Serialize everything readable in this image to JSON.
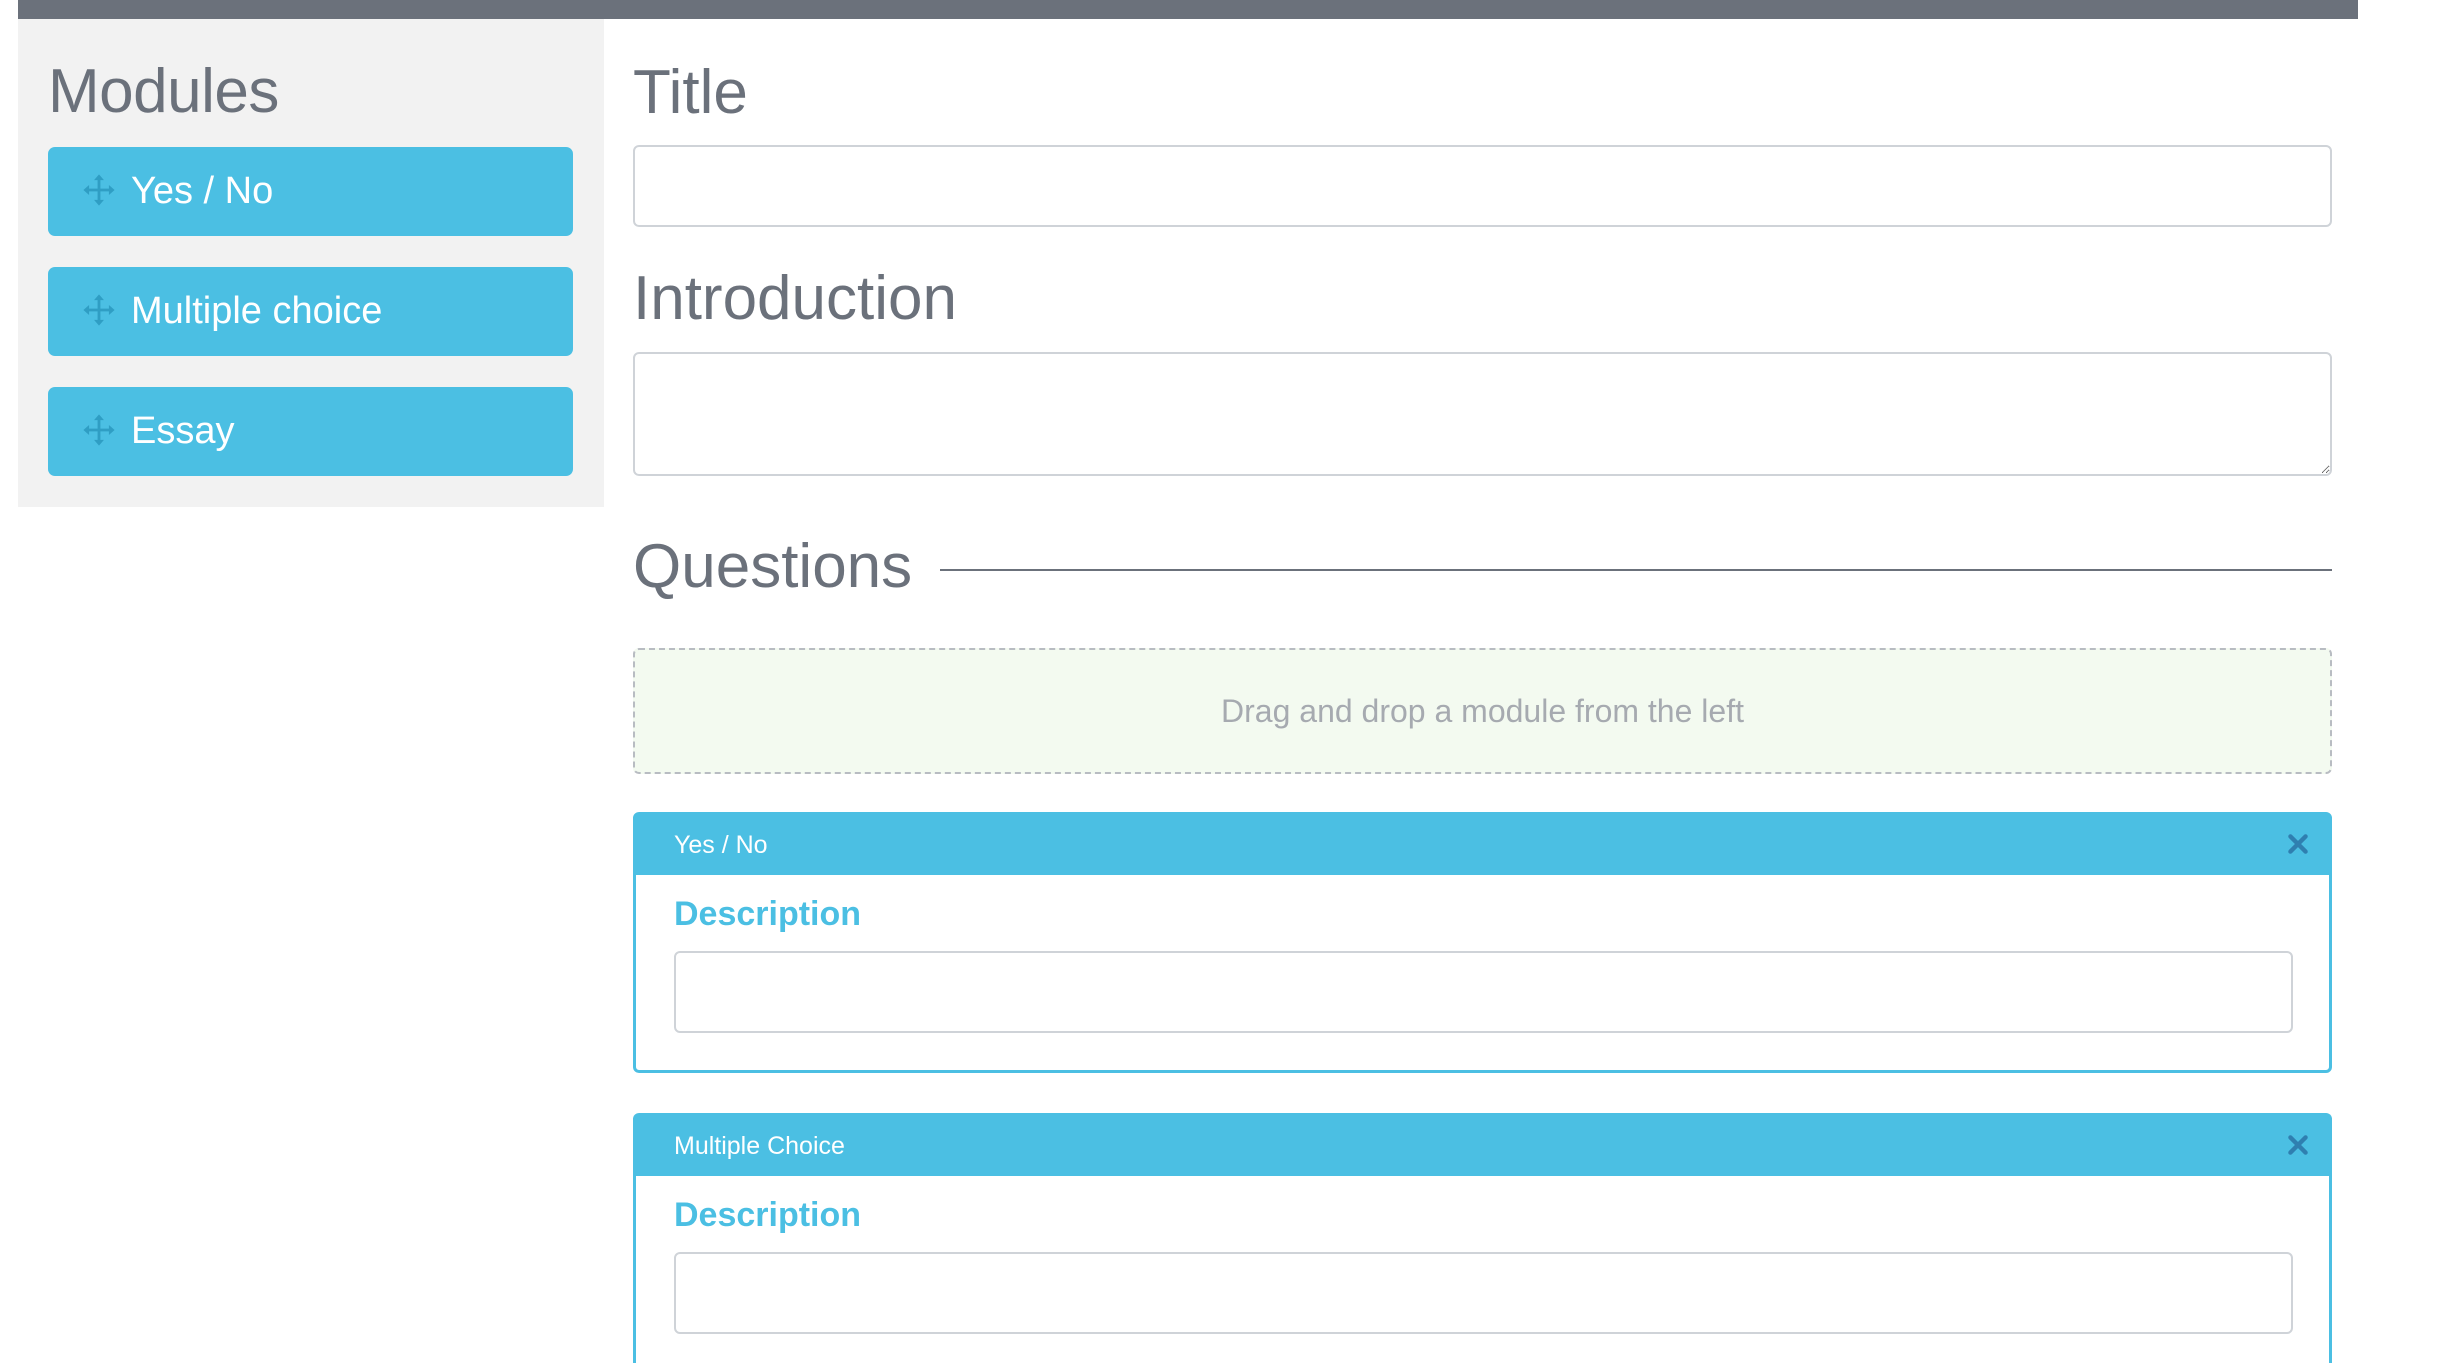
{
  "colors": {
    "accent": "#4bbfe3",
    "text_gray": "#6b717b",
    "sidebar_bg": "#f2f2f2",
    "dropzone_bg": "#f3faf0"
  },
  "sidebar": {
    "title": "Modules",
    "items": [
      {
        "label": "Yes / No",
        "icon": "move-icon"
      },
      {
        "label": "Multiple choice",
        "icon": "move-icon"
      },
      {
        "label": "Essay",
        "icon": "move-icon"
      }
    ]
  },
  "form": {
    "title_label": "Title",
    "title_value": "",
    "intro_label": "Introduction",
    "intro_value": "",
    "questions_label": "Questions",
    "dropzone_text": "Drag and drop a module from the left"
  },
  "questions": [
    {
      "type": "Yes / No",
      "description_label": "Description",
      "description_value": ""
    },
    {
      "type": "Multiple Choice",
      "description_label": "Description",
      "description_value": ""
    }
  ]
}
